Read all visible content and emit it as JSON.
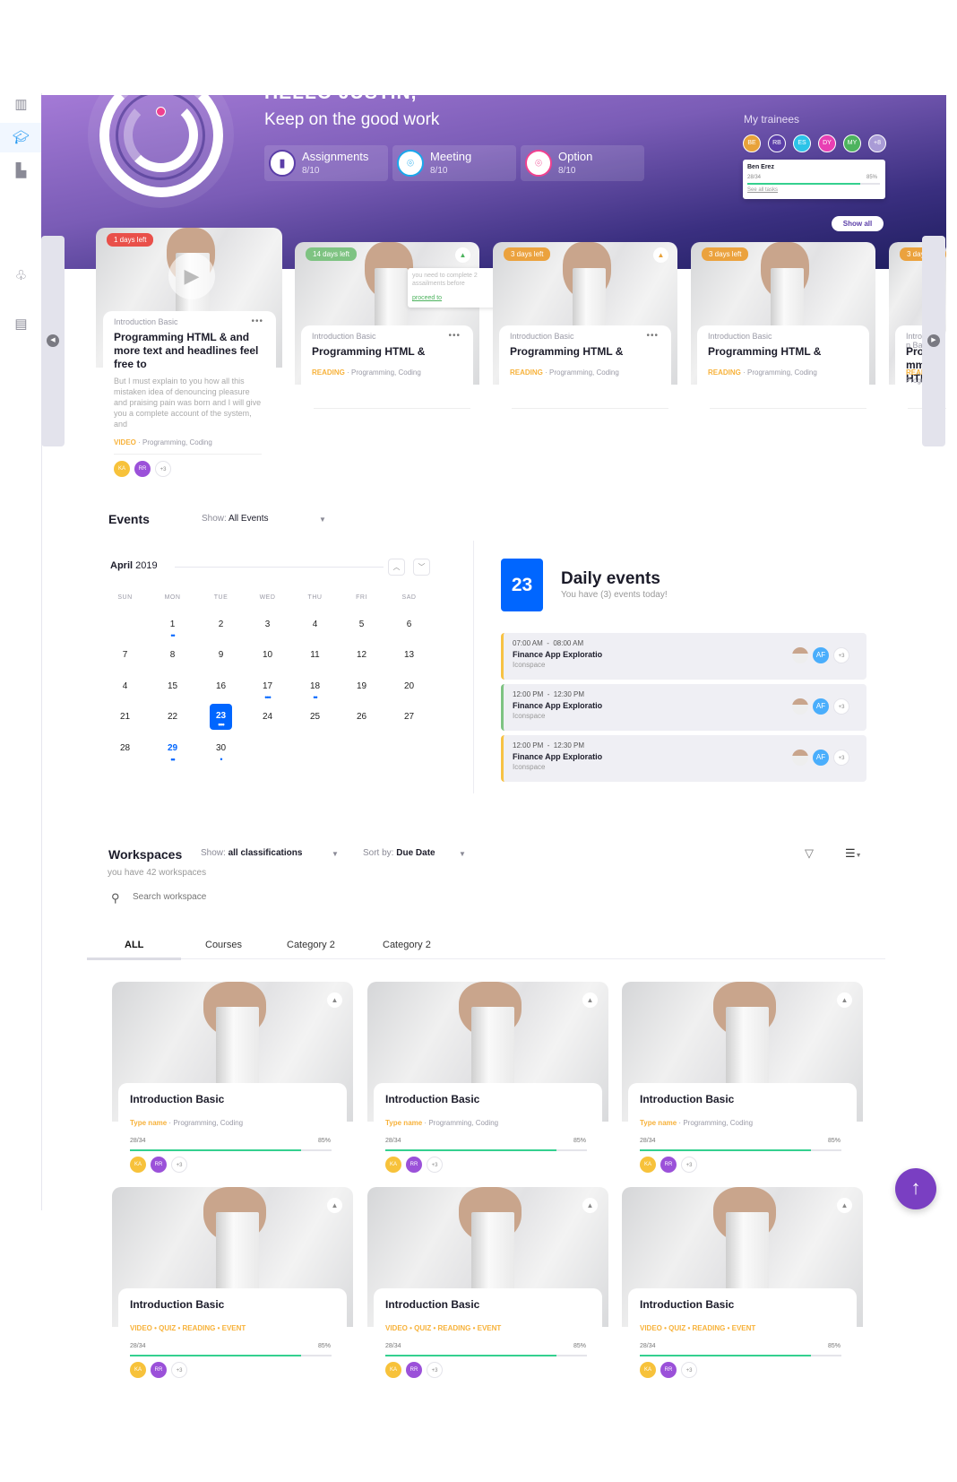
{
  "sidebar": {
    "items": [
      {
        "icon": "books-icon"
      },
      {
        "icon": "graduation-cap-icon",
        "active": true
      },
      {
        "icon": "bar-chart-icon"
      },
      {
        "icon": "award-icon"
      },
      {
        "icon": "clipboard-icon"
      }
    ]
  },
  "hero": {
    "greeting": "HELLO JUSTIN,",
    "subtitle": "Keep on the good work",
    "stats": [
      {
        "label": "Assignments",
        "value": "8/10",
        "icon": "clipboard-icon",
        "color": "#5b3ea8"
      },
      {
        "label": "Meeting",
        "value": "8/10",
        "icon": "location-pin-icon",
        "color": "#1aa7ec"
      },
      {
        "label": "Option",
        "value": "8/10",
        "icon": "location-pin-icon",
        "color": "#f0418f"
      }
    ],
    "trainees": {
      "title": "My trainees",
      "avatars": [
        {
          "initials": "BE",
          "color": "#e8a23a"
        },
        {
          "initials": "RB",
          "color": "#5b3ea8"
        },
        {
          "initials": "ES",
          "color": "#2cc3e8"
        },
        {
          "initials": "DY",
          "color": "#e83fb3"
        },
        {
          "initials": "MY",
          "color": "#4db35e"
        },
        {
          "initials": "+8",
          "color": "#a99bd6"
        }
      ],
      "tooltip": {
        "name": "Ben Erez",
        "progress": "28/34",
        "percent": "85%",
        "percent_value": 85,
        "link": "See all tasks"
      }
    },
    "show_all": "Show all"
  },
  "carousel": {
    "featured": {
      "badge": "1 days left",
      "badge_color": "#e9504a",
      "category": "Introduction Basic",
      "title": "Programming HTML & and more text and headlines feel free to",
      "description": "But I must explain to you how all this mistaken idea of denouncing pleasure and praising pain was born and I will give you a complete account of the system, and",
      "type": "VIDEO",
      "tags": "Programming, Coding",
      "avatars": [
        {
          "initials": "KA",
          "color": "#f7c23b"
        },
        {
          "initials": "RR",
          "color": "#9b51d9"
        }
      ],
      "more": "+3"
    },
    "cards": [
      {
        "badge": "14 days left",
        "badge_color": "#7ec382",
        "category": "Introduction Basic",
        "title": "Programming HTML &",
        "type": "READING",
        "tags": "Programming, Coding",
        "warning": true,
        "tooltip": "you need to complete 2 assailments before",
        "tooltip_link": "proceed to"
      },
      {
        "badge": "3 days left",
        "badge_color": "#eba23e",
        "category": "Introduction Basic",
        "title": "Programming HTML &",
        "type": "READING",
        "tags": "Programming, Coding",
        "warning": true
      },
      {
        "badge": "3 days left",
        "badge_color": "#eba23e",
        "category": "Introduction Basic",
        "title": "Programming HTML &",
        "type": "READING",
        "tags": "Programming, Coding"
      },
      {
        "badge": "3 days left",
        "badge_color": "#eba23e",
        "category": "Introduction Basic",
        "title": "Programming HTML &",
        "type": "READING",
        "tags": "Programming, Coding"
      }
    ]
  },
  "events": {
    "title": "Events",
    "show_label": "Show:",
    "show_value": "All Events",
    "calendar": {
      "month": "April",
      "year": "2019",
      "weekdays": [
        "SUN",
        "MON",
        "TUE",
        "WED",
        "THU",
        "FRI",
        "SAD"
      ],
      "weeks": [
        [
          "",
          "1",
          "2",
          "3",
          "4",
          "5",
          "6"
        ],
        [
          "7",
          "8",
          "9",
          "10",
          "11",
          "12",
          "13"
        ],
        [
          "4",
          "15",
          "16",
          "17",
          "18",
          "19",
          "20"
        ],
        [
          "21",
          "22",
          "23",
          "24",
          "25",
          "26",
          "27"
        ],
        [
          "28",
          "29",
          "30",
          "",
          "",
          "",
          ""
        ]
      ],
      "event_dots": {
        "1": 2,
        "17": 3,
        "18": 2,
        "23": 3,
        "29": 2,
        "30": 1
      },
      "selected": "23"
    },
    "daily": {
      "day": "23",
      "title": "Daily events",
      "subtitle": "You have (3) events today!",
      "items": [
        {
          "time": "07:00 AM  -  08:00 AM",
          "name": "Finance App Exploratio",
          "place": "Iconspace",
          "color": "#f7c244"
        },
        {
          "time": "12:00 PM  -  12:30 PM",
          "name": "Finance App Exploratio",
          "place": "Iconspace",
          "color": "#7ec382"
        },
        {
          "time": "12:00 PM  -  12:30 PM",
          "name": "Finance App Exploratio",
          "place": "Iconspace",
          "color": "#f7c244"
        }
      ],
      "avatar": "AF",
      "more": "+3"
    }
  },
  "workspaces": {
    "title": "Workspaces",
    "show_label": "Show:",
    "show_value": "all classifications",
    "sort_label": "Sort by:",
    "sort_value": "Due Date",
    "count_text": "you have 42 workspaces",
    "search_placeholder": "Search workspace",
    "tabs": [
      "ALL",
      "Courses",
      "Category 2",
      "Category 2"
    ],
    "active_tab": 0,
    "cards": [
      {
        "title": "Introduction Basic",
        "type": "Type name",
        "tags": "Programming, Coding",
        "progress": "28/34",
        "percent": "85%",
        "percent_value": 85
      },
      {
        "title": "Introduction Basic",
        "type": "Type name",
        "tags": "Programming, Coding",
        "progress": "28/34",
        "percent": "85%",
        "percent_value": 85
      },
      {
        "title": "Introduction Basic",
        "type": "Type name",
        "tags": "Programming, Coding",
        "progress": "28/34",
        "percent": "85%",
        "percent_value": 85
      },
      {
        "title": "Introduction Basic",
        "type": "VIDEO • QUIZ • READING • EVENT",
        "tags": "",
        "progress": "28/34",
        "percent": "85%",
        "percent_value": 85
      },
      {
        "title": "Introduction Basic",
        "type": "VIDEO • QUIZ • READING • EVENT",
        "tags": "",
        "progress": "28/34",
        "percent": "85%",
        "percent_value": 85
      },
      {
        "title": "Introduction Basic",
        "type": "VIDEO • QUIZ • READING • EVENT",
        "tags": "",
        "progress": "28/34",
        "percent": "85%",
        "percent_value": 85
      }
    ],
    "avatars": [
      {
        "initials": "KA",
        "color": "#f7c23b"
      },
      {
        "initials": "RR",
        "color": "#9b51d9"
      }
    ],
    "more": "+3"
  },
  "colors": {
    "accent": "#0066ff",
    "purple": "#7a3fc2",
    "progress": "#34d08f"
  }
}
